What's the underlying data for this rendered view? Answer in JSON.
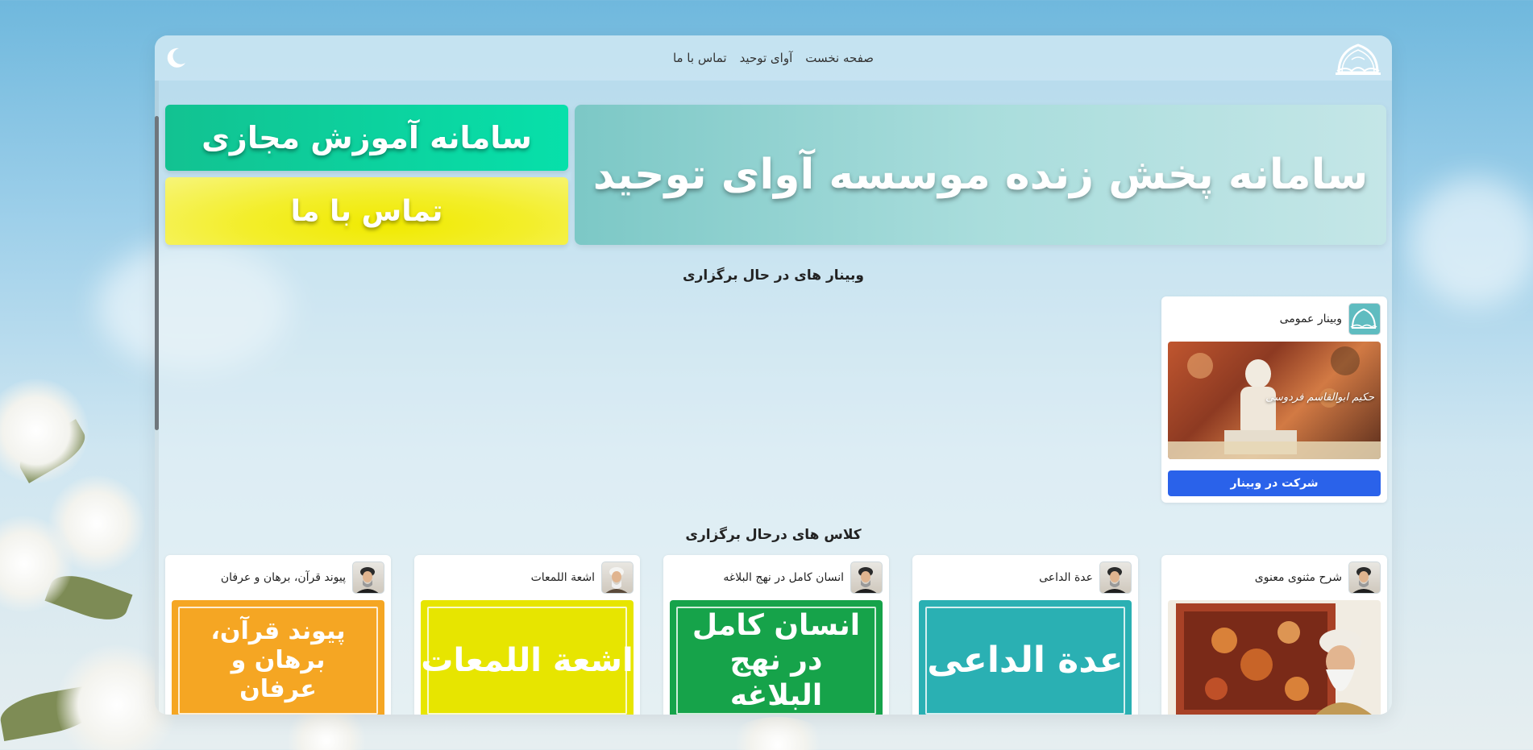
{
  "nav": {
    "items": [
      "صفحه نخست",
      "آوای توحید",
      "تماس با ما"
    ]
  },
  "hero": {
    "title": "سامانه پخش زنده موسسه آوای توحید"
  },
  "side_buttons": {
    "education": "سامانه آموزش مجازی",
    "contact": "تماس با ما"
  },
  "webinars": {
    "section_title": "وبینار های در حال برگزاری",
    "items": [
      {
        "title": "وبینار عمومی",
        "join_label": "شرکت در وبینار",
        "thumbnail_caption": "حکیم ابوالقاسم فردوسی"
      }
    ]
  },
  "classes": {
    "section_title": "کلاس های درحال برگزاری",
    "items": [
      {
        "title": "شرح مثنوی معنوی",
        "thumb_text": "",
        "color": "#b8472a"
      },
      {
        "title": "عدة الداعی",
        "thumb_text": "عدة الداعی",
        "color": "#2ab0b3"
      },
      {
        "title": "انسان کامل در نهج البلاغه",
        "thumb_text": "انسان کامل در نهج البلاغه",
        "color": "#16a34a"
      },
      {
        "title": "اشعة اللمعات",
        "thumb_text": "اشعة اللمعات",
        "color": "#e7e500"
      },
      {
        "title": "پیوند قرآن، برهان و عرفان",
        "thumb_text": "پیوند قرآن، برهان و عرفان",
        "color": "#f5a623"
      }
    ]
  },
  "colors": {
    "primary_button": "#2a62ea",
    "hero_gradient": "#7cc8c6",
    "education_button": "#12c291",
    "contact_button": "#f0ea00"
  },
  "icons": {
    "theme_toggle": "moon-icon",
    "logo": "institute-logo-icon"
  }
}
